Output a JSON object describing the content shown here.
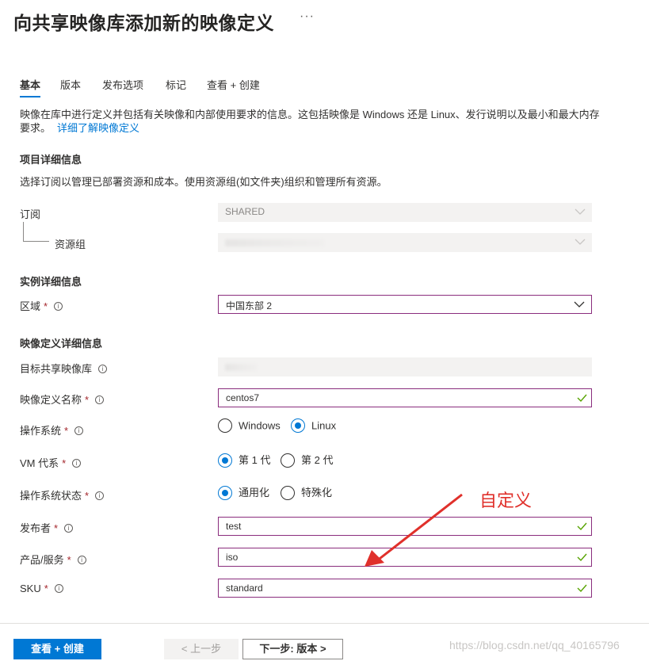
{
  "page": {
    "title": "向共享映像库添加新的映像定义",
    "more_icon": "···"
  },
  "tabs": [
    {
      "label": "基本",
      "active": true
    },
    {
      "label": "版本",
      "active": false
    },
    {
      "label": "发布选项",
      "active": false
    },
    {
      "label": "标记",
      "active": false
    },
    {
      "label": "查看 + 创建",
      "active": false
    }
  ],
  "description": {
    "text": "映像在库中进行定义并包括有关映像和内部使用要求的信息。这包括映像是 Windows 还是 Linux、发行说明以及最小和最大内存要求。",
    "link": "详细了解映像定义"
  },
  "project": {
    "heading": "项目详细信息",
    "text": "选择订阅以管理已部署资源和成本。使用资源组(如文件夹)组织和管理所有资源。",
    "subscription_label": "订阅",
    "subscription_value": "SHARED",
    "resource_group_label": "资源组"
  },
  "instance": {
    "heading": "实例详细信息",
    "region_label": "区域",
    "region_value": "中国东部 2"
  },
  "image_def": {
    "heading": "映像定义详细信息",
    "gallery_label": "目标共享映像库",
    "name_label": "映像定义名称",
    "name_value": "centos7",
    "os_label": "操作系统",
    "os_options": [
      "Windows",
      "Linux"
    ],
    "os_selected": "Linux",
    "vm_gen_label": "VM 代系",
    "vm_gen_options": [
      "第 1 代",
      "第 2 代"
    ],
    "vm_gen_selected": "第 1 代",
    "os_state_label": "操作系统状态",
    "os_state_options": [
      "通用化",
      "特殊化"
    ],
    "os_state_selected": "通用化",
    "publisher_label": "发布者",
    "publisher_value": "test",
    "offer_label": "产品/服务",
    "offer_value": "iso",
    "sku_label": "SKU",
    "sku_value": "standard"
  },
  "annotation": {
    "text": "自定义",
    "color": "#e0302b"
  },
  "footer": {
    "review_create": "查看 + 创建",
    "previous": "< 上一步",
    "next": "下一步: 版本 >"
  },
  "watermark": "https://blog.csdn.net/qq_40165796",
  "colors": {
    "accent": "#0078d4",
    "required": "#a4262c",
    "valid_check": "#57a300",
    "field_border": "#8a2d7d"
  }
}
